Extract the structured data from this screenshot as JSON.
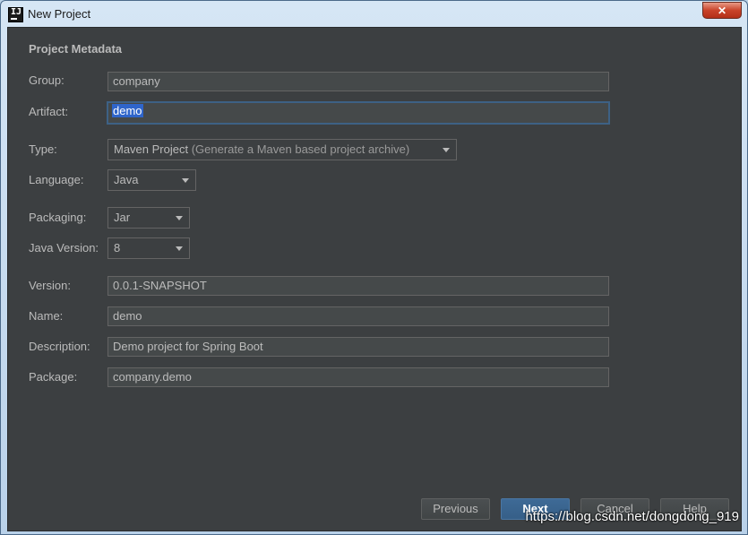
{
  "window": {
    "title": "New Project",
    "close_symbol": "✕"
  },
  "section": {
    "title": "Project Metadata"
  },
  "fields": {
    "group": {
      "label": "Group:",
      "value": "company"
    },
    "artifact": {
      "label": "Artifact:",
      "value": "demo"
    },
    "type": {
      "label": "Type:",
      "value": "Maven Project",
      "hint": "(Generate a Maven based project archive)"
    },
    "language": {
      "label": "Language:",
      "value": "Java"
    },
    "packaging": {
      "label": "Packaging:",
      "value": "Jar"
    },
    "java_version": {
      "label": "Java Version:",
      "value": "8"
    },
    "version": {
      "label": "Version:",
      "value": "0.0.1-SNAPSHOT"
    },
    "name": {
      "label": "Name:",
      "value": "demo"
    },
    "description": {
      "label": "Description:",
      "value": "Demo project for Spring Boot"
    },
    "package": {
      "label": "Package:",
      "value": "company.demo"
    }
  },
  "buttons": {
    "previous": "Previous",
    "next": "Next",
    "cancel": "Cancel",
    "help": "Help"
  },
  "watermark": "https://blog.csdn.net/dongdong_919",
  "icons": {
    "app": "intellij-idea-icon",
    "close": "close-icon",
    "dropdown": "chevron-down-icon"
  },
  "colors": {
    "panel_background": "#3c3f41",
    "text": "#bbbbbb",
    "selection": "#2f65ca",
    "primary_button": "#365f88"
  }
}
